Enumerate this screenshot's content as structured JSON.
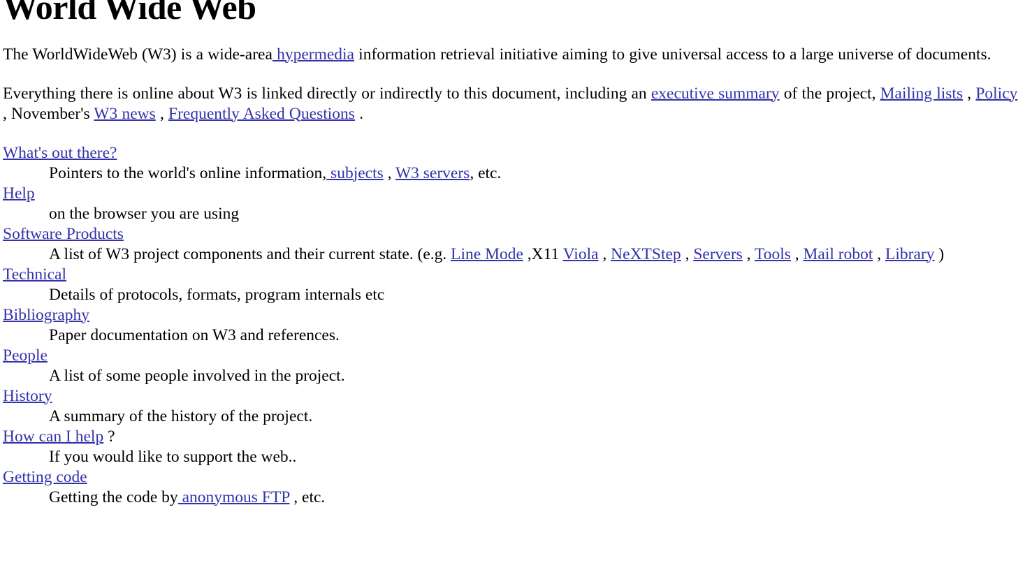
{
  "page": {
    "title": "World Wide Web",
    "link_color": "#3333aa",
    "text_color": "#000000",
    "background_color": "#ffffff"
  },
  "intro": {
    "p1_part1": "The WorldWideWeb (W3) is a wide-area",
    "p1_link_hypermedia": " hypermedia",
    "p1_part2": " information retrieval initiative aiming to give universal access to a large universe of documents.",
    "p2_part1": "Everything there is online about W3 is linked directly or indirectly to this document, including an ",
    "p2_link_exec": "executive summary",
    "p2_part2": " of the project, ",
    "p2_link_mailing": "Mailing lists",
    "p2_sep1": " , ",
    "p2_link_policy": "Policy",
    "p2_sep2": " , November's ",
    "p2_link_w3news": "W3 news",
    "p2_sep3": " , ",
    "p2_link_faq": "Frequently Asked Questions",
    "p2_end": " ."
  },
  "entries": [
    {
      "term": "What's out there?",
      "def_part1": "Pointers to the world's online information,",
      "def_link1": " subjects",
      "def_sep1": " , ",
      "def_link2": "W3 servers",
      "def_part2": ", etc."
    },
    {
      "term": "Help",
      "def_part1": "on the browser you are using"
    },
    {
      "term": "Software Products",
      "def_part1": "A list of W3 project components and their current state. (e.g. ",
      "links": [
        {
          "label": "Line Mode",
          "after": " ,X11 "
        },
        {
          "label": "Viola",
          "after": " , "
        },
        {
          "label": "NeXTStep",
          "after": " , "
        },
        {
          "label": "Servers",
          "after": " , "
        },
        {
          "label": "Tools",
          "after": " , "
        },
        {
          "label": "Mail robot",
          "after": " , "
        },
        {
          "label": "Library",
          "after": " )"
        }
      ]
    },
    {
      "term": "Technical",
      "def_part1": "Details of protocols, formats, program internals etc"
    },
    {
      "term": "Bibliography",
      "def_part1": "Paper documentation on W3 and references."
    },
    {
      "term": "People",
      "def_part1": "A list of some people involved in the project."
    },
    {
      "term": "History",
      "def_part1": "A summary of the history of the project."
    },
    {
      "term": "How can I help",
      "term_suffix": " ?",
      "def_part1": "If you would like to support the web.."
    },
    {
      "term": "Getting code",
      "def_part1": "Getting the code by",
      "def_link1": " anonymous FTP",
      "def_part2": " , etc."
    }
  ]
}
